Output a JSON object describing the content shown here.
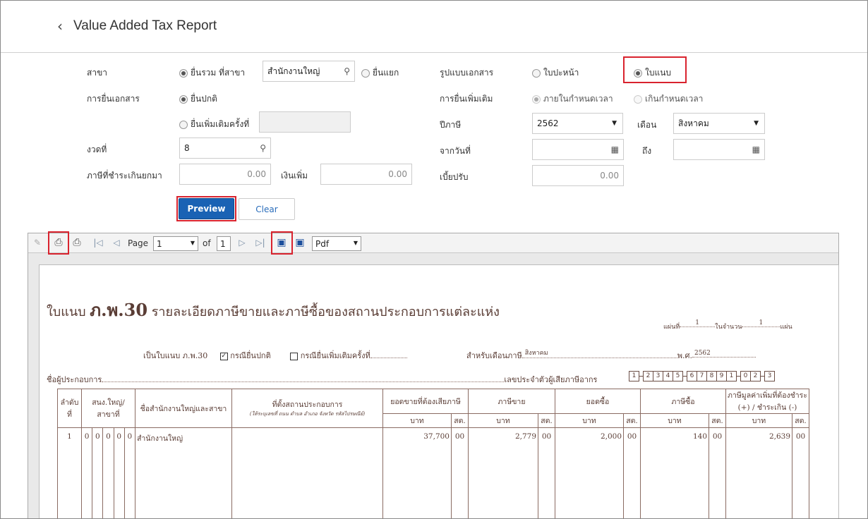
{
  "header": {
    "back_icon": "chevron-left-icon",
    "title": "Value Added Tax Report"
  },
  "form": {
    "branch_label": "สาขา",
    "branch_combined": "ยื่นรวม ที่สาขา",
    "branch_value": "สำนักงานใหญ่",
    "branch_separate": "ยื่นแยก",
    "doc_format_label": "รูปแบบเอกสาร",
    "doc_cover": "ใบปะหน้า",
    "doc_attach": "ใบแนบ",
    "filing_label": "การยื่นเอกสาร",
    "filing_normal": "ยื่นปกติ",
    "filing_additional": "ยื่นเพิ่มเติมครั้งที่",
    "extra_label": "การยื่นเพิ่มเติม",
    "extra_within": "ภายในกำหนดเวลา",
    "extra_over": "เกินกำหนดเวลา",
    "tax_year_label": "ปีภาษี",
    "tax_year": "2562",
    "month_label": "เดือน",
    "month": "สิงหาคม",
    "period_label": "งวดที่",
    "period": "8",
    "from_label": "จากวันที่",
    "to_label": "ถึง",
    "overpaid_label": "ภาษีที่ชำระเกินยกมา",
    "overpaid": "0.00",
    "surcharge_label": "เงินเพิ่ม",
    "surcharge": "0.00",
    "penalty_label": "เบี้ยปรับ",
    "penalty": "0.00",
    "preview": "Preview",
    "clear": "Clear"
  },
  "toolbar": {
    "page_label": "Page",
    "page": "1",
    "of_label": "of",
    "total": "1",
    "format": "Pdf"
  },
  "report": {
    "heading_prefix": "ใบแนบ",
    "heading_form": "ภ.พ.30",
    "heading_rest": "รายละเอียดภาษีขายและภาษีซื้อของสถานประกอบการแต่ละแห่ง",
    "sheet_label": "แผ่นที่",
    "sheet_no": "1",
    "total_label": "ในจำนวน",
    "total_no": "1",
    "sheet_unit": "แผ่น",
    "attach_label": "เป็นใบแนบ ภ.พ.30",
    "check_mark": "✓",
    "case_normal": "กรณียื่นปกติ",
    "case_extra": "กรณียื่นเพิ่มเติมครั้งที่",
    "for_month_label": "สำหรับเดือนภาษี",
    "month": "สิงหาคม",
    "year_label": "พ.ศ.",
    "year": "2562",
    "operator_label": "ชื่อผู้ประกอบการ",
    "taxid_label": "เลขประจำตัวผู้เสียภาษีอากร",
    "taxid": [
      "1",
      "2",
      "3",
      "4",
      "5",
      "6",
      "7",
      "8",
      "9",
      "1",
      "0",
      "2",
      "3"
    ],
    "cols": {
      "no": "ลำดับที่",
      "hq": "สนง.ใหญ่/สาขาที่",
      "name": "ชื่อสำนักงานใหญ่และสาขา",
      "location": "ที่ตั้งสถานประกอบการ",
      "location_sub": "(ให้ระบุเลขที่ ถนน ตำบล อำเภอ จังหวัด รหัสไปรษณีย์)",
      "sales": "ยอดขายที่ต้องเสียภาษี",
      "output_tax": "ภาษีขาย",
      "purchases": "ยอดซื้อ",
      "input_tax": "ภาษีซื้อ",
      "vat": "ภาษีมูลค่าเพิ่มที่ต้องชำระ (+) / ชำระเกิน (-)",
      "baht": "บาท",
      "satang": "สต."
    },
    "rows": [
      {
        "no": "1",
        "hq": [
          "0",
          "0",
          "0",
          "0",
          "0"
        ],
        "name": "สำนักงานใหญ่",
        "location": "",
        "sales": "37,700",
        "sales_st": "00",
        "output": "2,779",
        "output_st": "00",
        "purchases": "2,000",
        "purchases_st": "00",
        "input": "140",
        "input_st": "00",
        "vat": "2,639",
        "vat_st": "00"
      }
    ]
  }
}
